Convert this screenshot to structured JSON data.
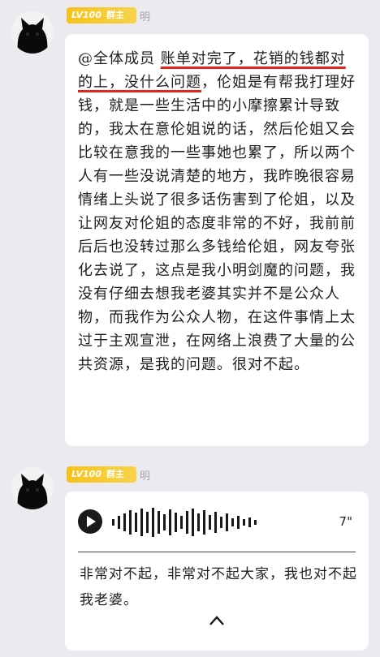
{
  "messages": [
    {
      "badge_level": "LV100",
      "badge_role": "群主",
      "nickname": "明",
      "text_plain_before": "@全体成员 ",
      "text_underlined": "账单对完了，花销的钱都对的上，没什么问题",
      "text_after": "，伦姐是有帮我打理好钱，就是一些生活中的小摩擦累计导致的，我太在意伦姐说的话，然后伦姐又会比较在意我的一些事她也累了，所以两个人有一些没说清楚的地方，我昨晚很容易情绪上头说了很多话伤害到了伦姐，以及让网友对伦姐的态度非常的不好，我前前后后也没转过那么多钱给伦姐，网友夸张化去说了，这点是我小明剑魔的问题，我没有仔细去想我老婆其实并不是公众人物，而我作为公众人物，在这件事情上太过于主观宣泄，在网络上浪费了大量的公共资源，是我的问题。很对不起。"
    },
    {
      "badge_level": "LV100",
      "badge_role": "群主",
      "nickname": "明",
      "voice_duration": "7\"",
      "transcript": "非常对不起，非常对不起大家，我也对不起我老婆。",
      "icons": [
        "play-icon",
        "waveform-icon",
        "chevron-up-icon"
      ]
    }
  ],
  "colors": {
    "badge": "#f5c21b",
    "underline": "#e2261e",
    "background": "#eceaee"
  }
}
